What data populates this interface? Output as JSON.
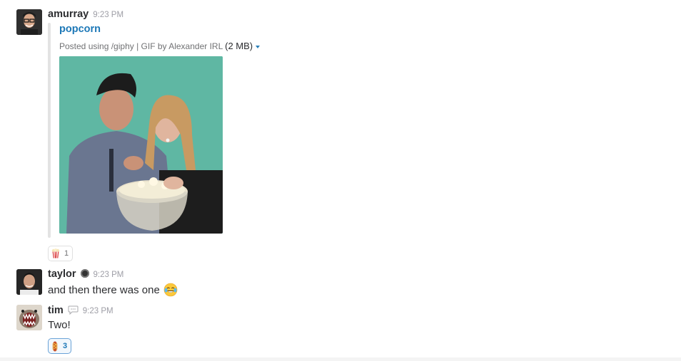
{
  "messages": [
    {
      "author": "amurray",
      "time": "9:23 PM",
      "attachment": {
        "title": "popcorn",
        "meta_text": "Posted using /giphy | GIF by Alexander IRL",
        "size": "(2 MB)",
        "image_alt": "GIF of two people eating popcorn"
      },
      "reactions": [
        {
          "emoji": "popcorn",
          "count": "1",
          "mine": false
        }
      ]
    },
    {
      "author": "taylor",
      "time": "9:23 PM",
      "status_icon": "dark-circle-status-icon",
      "text": "and then there was one",
      "inline_emoji": "joy-emoji"
    },
    {
      "author": "tim",
      "time": "9:23 PM",
      "status_icon": "speech-bubble-icon",
      "text": "Two!",
      "reactions": [
        {
          "emoji": "hotdog",
          "count": "3",
          "mine": true
        }
      ]
    }
  ],
  "colors": {
    "link": "#1d78b7",
    "timestamp": "#9e9ea6",
    "reaction_mine_border": "#6aa3d8"
  }
}
